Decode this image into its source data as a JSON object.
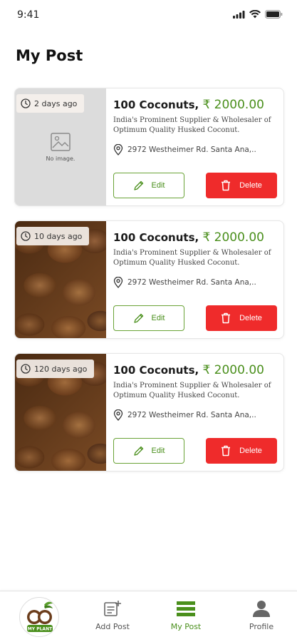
{
  "status_bar": {
    "time": "9:41"
  },
  "page": {
    "title": "My Post"
  },
  "posts": [
    {
      "age": "2 days ago",
      "image": "placeholder",
      "placeholder_text": "No image.",
      "title": "100 Coconuts,",
      "price": "₹ 2000.00",
      "description": "India's Prominent Supplier & Wholesaler of Optimum Quality Husked Coconut.",
      "location": "2972 Westheimer Rd. Santa Ana,..",
      "edit_label": "Edit",
      "delete_label": "Delete"
    },
    {
      "age": "10 days ago",
      "image": "coconuts",
      "title": "100 Coconuts,",
      "price": "₹ 2000.00",
      "description": "India's Prominent Supplier & Wholesaler of Optimum Quality Husked Coconut.",
      "location": "2972 Westheimer Rd. Santa Ana,..",
      "edit_label": "Edit",
      "delete_label": "Delete"
    },
    {
      "age": "120 days ago",
      "image": "coconuts",
      "title": "100 Coconuts,",
      "price": "₹ 2000.00",
      "description": "India's Prominent Supplier & Wholesaler of Optimum Quality Husked Coconut.",
      "location": "2972 Westheimer Rd. Santa Ana,..",
      "edit_label": "Edit",
      "delete_label": "Delete"
    }
  ],
  "bottom_nav": {
    "logo_text": "MY PLANT",
    "items": [
      {
        "label": "Add Post",
        "icon": "add-post-icon",
        "active": false
      },
      {
        "label": "My Post",
        "icon": "my-post-icon",
        "active": true
      },
      {
        "label": "Profile",
        "icon": "profile-icon",
        "active": false
      }
    ]
  },
  "colors": {
    "accent_green": "#4a8f1c",
    "delete_red": "#ef2b2b"
  }
}
